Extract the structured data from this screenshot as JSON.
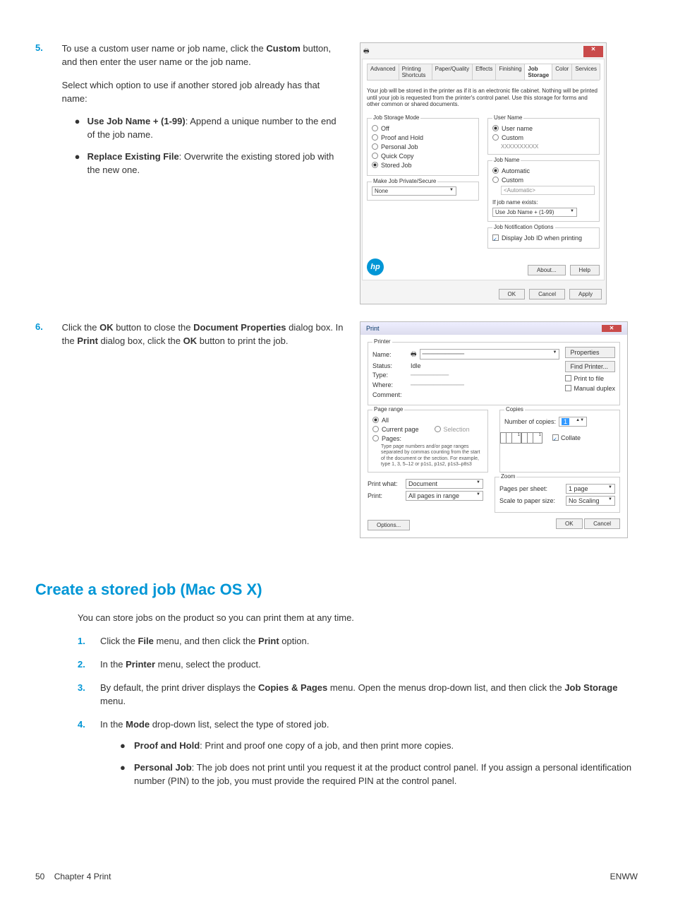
{
  "step5": {
    "num": "5.",
    "p1a": "To use a custom user name or job name, click the ",
    "p1b": "Custom",
    "p1c": " button, and then enter the user name or the job name.",
    "p2": "Select which option to use if another stored job already has that name:",
    "bullet1a": "Use Job Name + (1-99)",
    "bullet1b": ": Append a unique number to the end of the job name.",
    "bullet2a": "Replace Existing File",
    "bullet2b": ": Overwrite the existing stored job with the new one."
  },
  "properties": {
    "close": "✕",
    "tabs": [
      "Advanced",
      "Printing Shortcuts",
      "Paper/Quality",
      "Effects",
      "Finishing",
      "Job Storage",
      "Color",
      "Services"
    ],
    "active_tab": 5,
    "desc": "Your job will be stored in the printer as if it is an electronic file cabinet. Nothing will be printed until your job is requested from the printer's control panel. Use this storage for forms and other common or shared documents.",
    "mode_legend": "Job Storage Mode",
    "modes": [
      "Off",
      "Proof and Hold",
      "Personal Job",
      "Quick Copy",
      "Stored Job"
    ],
    "mode_checked": 4,
    "private_legend": "Make Job Private/Secure",
    "private_value": "None",
    "username_legend": "User Name",
    "username_opts": [
      "User name",
      "Custom"
    ],
    "username_checked": 0,
    "username_value": "XXXXXXXXXX",
    "jobname_legend": "Job Name",
    "jobname_opts": [
      "Automatic",
      "Custom"
    ],
    "jobname_checked": 0,
    "jobname_value": "<Automatic>",
    "exists_label": "If job name exists:",
    "exists_value": "Use Job Name + (1-99)",
    "notify_legend": "Job Notification Options",
    "notify_label": "Display Job ID when printing",
    "about": "About...",
    "help": "Help",
    "ok": "OK",
    "cancel": "Cancel",
    "apply": "Apply"
  },
  "step6": {
    "num": "6.",
    "p1a": "Click the ",
    "p1b": "OK",
    "p1c": " button to close the ",
    "p1d": "Document Properties",
    "p1e": " dialog box. In the ",
    "p1f": "Print",
    "p1g": " dialog box, click the ",
    "p1h": "OK",
    "p1i": " button to print the job."
  },
  "print_dlg": {
    "title": "Print",
    "close": "✕",
    "printer_legend": "Printer",
    "name_label": "Name:",
    "status_label": "Status:",
    "status_value": "Idle",
    "type_label": "Type:",
    "where_label": "Where:",
    "comment_label": "Comment:",
    "properties_btn": "Properties",
    "find_btn": "Find Printer...",
    "print_to_file": "Print to file",
    "manual_duplex": "Manual duplex",
    "page_range_legend": "Page range",
    "range_all": "All",
    "range_current": "Current page",
    "range_selection": "Selection",
    "range_pages": "Pages:",
    "range_hint": "Type page numbers and/or page ranges separated by commas counting from the start of the document or the section. For example, type 1, 3, 5–12 or p1s1, p1s2, p1s3–p8s3",
    "copies_legend": "Copies",
    "copies_label": "Number of copies:",
    "copies_value": "1",
    "collate": "Collate",
    "print_what_label": "Print what:",
    "print_what_value": "Document",
    "print_label": "Print:",
    "print_value": "All pages in range",
    "zoom_legend": "Zoom",
    "pages_per_label": "Pages per sheet:",
    "pages_per_value": "1 page",
    "scale_label": "Scale to paper size:",
    "scale_value": "No Scaling",
    "options_btn": "Options...",
    "ok_btn": "OK",
    "cancel_btn": "Cancel"
  },
  "section_title": "Create a stored job (Mac OS X)",
  "intro_text": "You can store jobs on the product so you can print them at any time.",
  "mac_steps": {
    "s1": {
      "num": "1.",
      "a": "Click the ",
      "b": "File",
      "c": " menu, and then click the ",
      "d": "Print",
      "e": " option."
    },
    "s2": {
      "num": "2.",
      "a": "In the ",
      "b": "Printer",
      "c": " menu, select the product."
    },
    "s3": {
      "num": "3.",
      "a": "By default, the print driver displays the ",
      "b": "Copies & Pages",
      "c": " menu. Open the menus drop-down list, and then click the ",
      "d": "Job Storage",
      "e": " menu."
    },
    "s4": {
      "num": "4.",
      "a": "In the ",
      "b": "Mode",
      "c": " drop-down list, select the type of stored job.",
      "bul1a": "Proof and Hold",
      "bul1b": ": Print and proof one copy of a job, and then print more copies.",
      "bul2a": "Personal Job",
      "bul2b": ": The job does not print until you request it at the product control panel. If you assign a personal identification number (PIN) to the job, you must provide the required PIN at the control panel."
    }
  },
  "footer": {
    "left_page": "50",
    "left_chapter": "Chapter 4   Print",
    "right": "ENWW"
  }
}
